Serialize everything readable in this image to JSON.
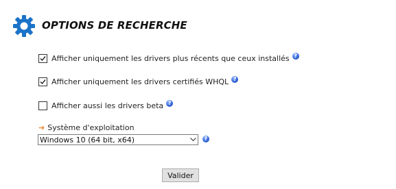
{
  "header": {
    "title": "OPTIONS DE RECHERCHE",
    "icon": "gear-icon",
    "icon_color": "#1a73c8"
  },
  "options": [
    {
      "label": "Afficher uniquement les drivers plus récents que ceux installés",
      "checked": true,
      "help_icon": "question-icon"
    },
    {
      "label": "Afficher uniquement les drivers certifiés WHQL",
      "checked": true,
      "help_icon": "question-icon"
    },
    {
      "label": "Afficher aussi les drivers beta",
      "checked": false,
      "help_icon": "question-icon"
    }
  ],
  "os": {
    "label": "Système d'exploitation",
    "arrow_icon": "arrow-right-icon",
    "arrow_color": "#e8862a",
    "selected": "Windows 10 (64 bit, x64)",
    "help_icon": "question-icon"
  },
  "submit": {
    "label": "Valider"
  },
  "help_glyph": "?"
}
